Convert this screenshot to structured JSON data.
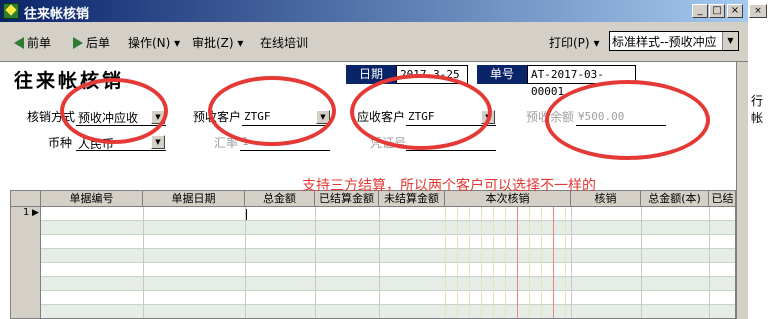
{
  "window": {
    "title": "往来帐核销",
    "minimize": "_",
    "maximize": "□",
    "close": "×"
  },
  "toolbar": {
    "prev": "前单",
    "next": "后单",
    "operate": "操作(N)",
    "approve": "审批(Z)",
    "online_training": "在线培训",
    "print": "打印(P)",
    "style_value": "标准样式--预收冲应"
  },
  "form": {
    "title": "往来帐核销",
    "date_label": "日期",
    "date_value": "2017-3-25",
    "doc_no_label": "单号",
    "doc_no_value": "AT-2017-03-00001",
    "method_label": "核销方式",
    "method_value": "预收冲应收",
    "currency_label": "币种",
    "currency_value": "人民币",
    "prepay_customer_label": "预收客户",
    "prepay_customer_value": "ZTGF",
    "rate_label": "汇率",
    "rate_value": "1",
    "receivable_customer_label": "应收客户",
    "receivable_customer_value": "ZTGF",
    "voucher_label": "凭证号",
    "prepay_balance_label": "预收余额",
    "prepay_balance_value": "¥500.00"
  },
  "grid": {
    "columns": [
      "单据编号",
      "单据日期",
      "总金额",
      "已结算金额",
      "未结算金额",
      "本次核销",
      "核销",
      "总金额(本)",
      "已结"
    ],
    "first_row_no": "1"
  },
  "annotation": "支持三方结算，所以两个客户可以选择不一样的",
  "right_panel": {
    "label": "行帐"
  },
  "colors": {
    "title_bar": "#0a246a",
    "highlight": "#e53935",
    "row_alt": "#e6ece6"
  }
}
